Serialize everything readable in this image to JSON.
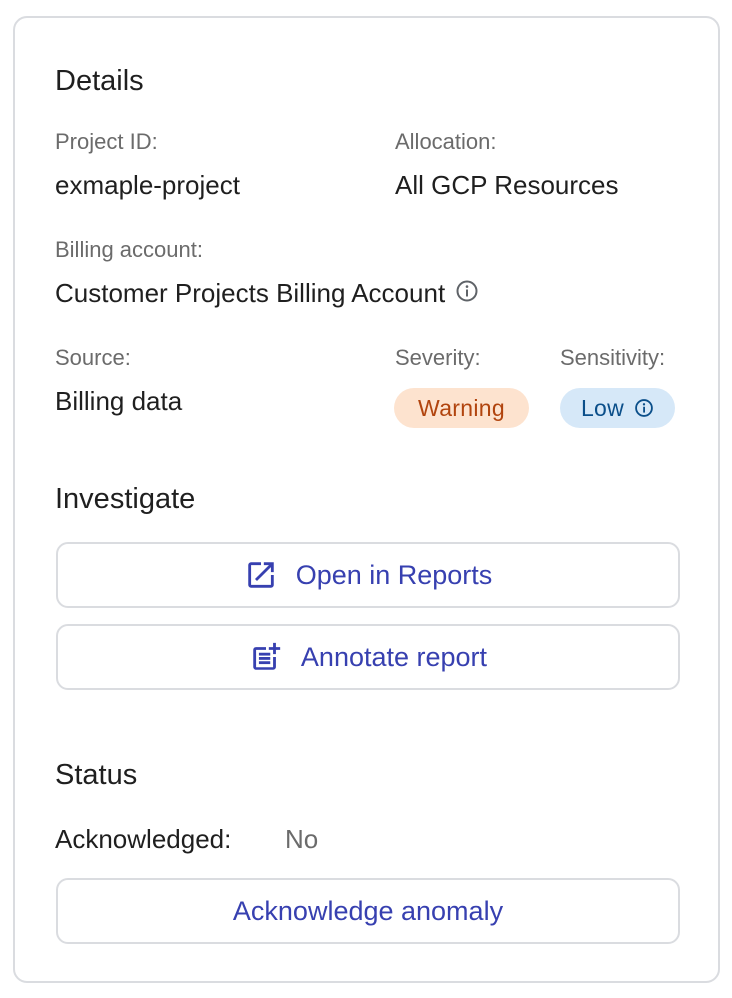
{
  "details": {
    "title": "Details",
    "project_id_label": "Project ID:",
    "project_id_value": "exmaple-project",
    "allocation_label": "Allocation:",
    "allocation_value": "All GCP Resources",
    "billing_account_label": "Billing account:",
    "billing_account_value": "Customer Projects Billing Account",
    "source_label": "Source:",
    "source_value": "Billing data",
    "severity_label": "Severity:",
    "severity_value": "Warning",
    "sensitivity_label": "Sensitivity:",
    "sensitivity_value": "Low"
  },
  "investigate": {
    "title": "Investigate",
    "open_reports_label": "Open in Reports",
    "annotate_report_label": "Annotate report"
  },
  "status": {
    "title": "Status",
    "acknowledged_label": "Acknowledged:",
    "acknowledged_value": "No",
    "acknowledge_button_label": "Acknowledge anomaly"
  },
  "colors": {
    "accent": "#3740b0",
    "warning_bg": "#fde3cf",
    "warning_text": "#b1440e",
    "low_bg": "#d6e8f8",
    "low_text": "#0b4f8a",
    "border": "#dadce0"
  },
  "icons": {
    "billing_info": "info-icon",
    "sensitivity_info": "info-icon",
    "open_reports": "open-in-new-icon",
    "annotate_report": "post-add-icon"
  }
}
